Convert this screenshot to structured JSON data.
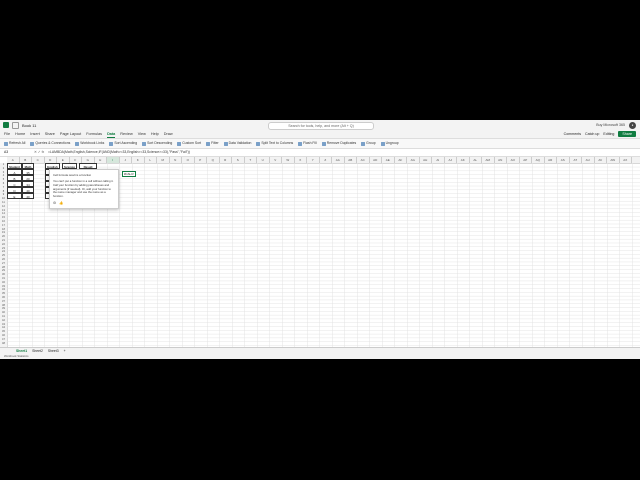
{
  "titlebar": {
    "file_name": "Book 11",
    "search_placeholder": "Search for tools, help, and more (Alt + Q)",
    "buy": "Buy Microsoft 365"
  },
  "menu": {
    "items": [
      "File",
      "Home",
      "Insert",
      "Share",
      "Page Layout",
      "Formulas",
      "Data",
      "Review",
      "View",
      "Help",
      "Draw"
    ],
    "active": "Data",
    "comments": "Comments",
    "catchup": "Catch up",
    "editing": "Editing",
    "share": "Share"
  },
  "ribbon": {
    "items": [
      "Refresh All",
      "Queries & Connections",
      "Workbook Links",
      "Sort Ascending",
      "Sort Descending",
      "Custom Sort",
      "Filter",
      "Data Validation",
      "Split Text to Columns",
      "Flash Fill",
      "Remove Duplicates",
      "Group",
      "Ungroup"
    ]
  },
  "formula_bar": {
    "name_box": "A3",
    "fx": "✕ ✓ fx",
    "formula": "=LAMBDA(Math,English,Science,IF(AND(Math>=33,English>=33,Science>=33),\"Pass\",\"Fail\"))"
  },
  "columns": [
    "A",
    "B",
    "C",
    "D",
    "E",
    "F",
    "G",
    "H",
    "I",
    "J",
    "K",
    "L",
    "M",
    "N",
    "O",
    "P",
    "Q",
    "R",
    "S",
    "T",
    "U",
    "V",
    "W",
    "X",
    "Y",
    "Z",
    "AA",
    "AB",
    "AC",
    "AD",
    "AE",
    "AF",
    "AG",
    "AH",
    "AI",
    "AJ",
    "AK",
    "AL",
    "AM",
    "AN",
    "AO",
    "AP",
    "AQ",
    "AR",
    "AS",
    "AT",
    "AU",
    "AV",
    "AW",
    "AX"
  ],
  "selected_column": "I",
  "table": {
    "headers": [
      "Student Name",
      "Math",
      "English",
      "Science",
      "Result"
    ],
    "rows": [
      [
        "A",
        "35",
        "",
        ""
      ],
      [
        "B",
        "20",
        "",
        ""
      ],
      [
        "C",
        "34",
        "",
        ""
      ],
      [
        "D",
        "40",
        "",
        ""
      ],
      [
        "E",
        "40",
        "",
        ""
      ]
    ]
  },
  "selected_cell_value": "#CALC!",
  "tooltip": {
    "title": "Cell formula result is a function",
    "body": "You can't put a function in a cell without calling it. Call your function by adding parentheses and arguments (if needed). Or, add your function to the name manager and use the name as a function.",
    "actions": [
      "⚙",
      "👍"
    ]
  },
  "sheets": [
    "Sheet1",
    "Sheet2",
    "Sheet3"
  ],
  "active_sheet": "Sheet1",
  "status": "Workbook Statistics"
}
